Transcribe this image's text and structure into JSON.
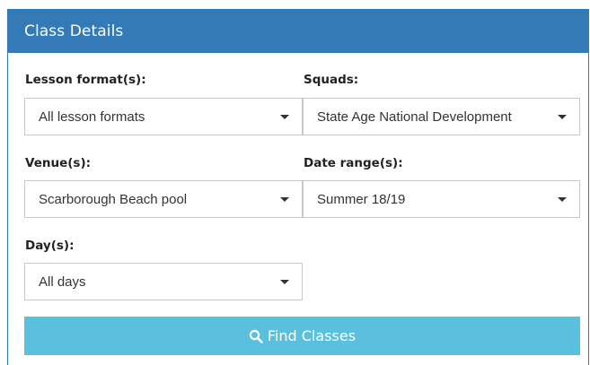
{
  "panel": {
    "title": "Class Details"
  },
  "fields": {
    "lesson_formats": {
      "label": "Lesson format(s):",
      "value": "All lesson formats"
    },
    "squads": {
      "label": "Squads:",
      "value": "State Age National Development"
    },
    "venues": {
      "label": "Venue(s):",
      "value": "Scarborough Beach pool"
    },
    "date_range": {
      "label": "Date range(s):",
      "value": "Summer 18/19"
    },
    "days": {
      "label": "Day(s):",
      "value": "All days"
    }
  },
  "actions": {
    "find_label": "Find Classes"
  },
  "colors": {
    "heading": "#337ab7",
    "button": "#5bc0de"
  },
  "icons": {
    "select_caret": "chevron-down-icon",
    "find": "search-icon"
  }
}
